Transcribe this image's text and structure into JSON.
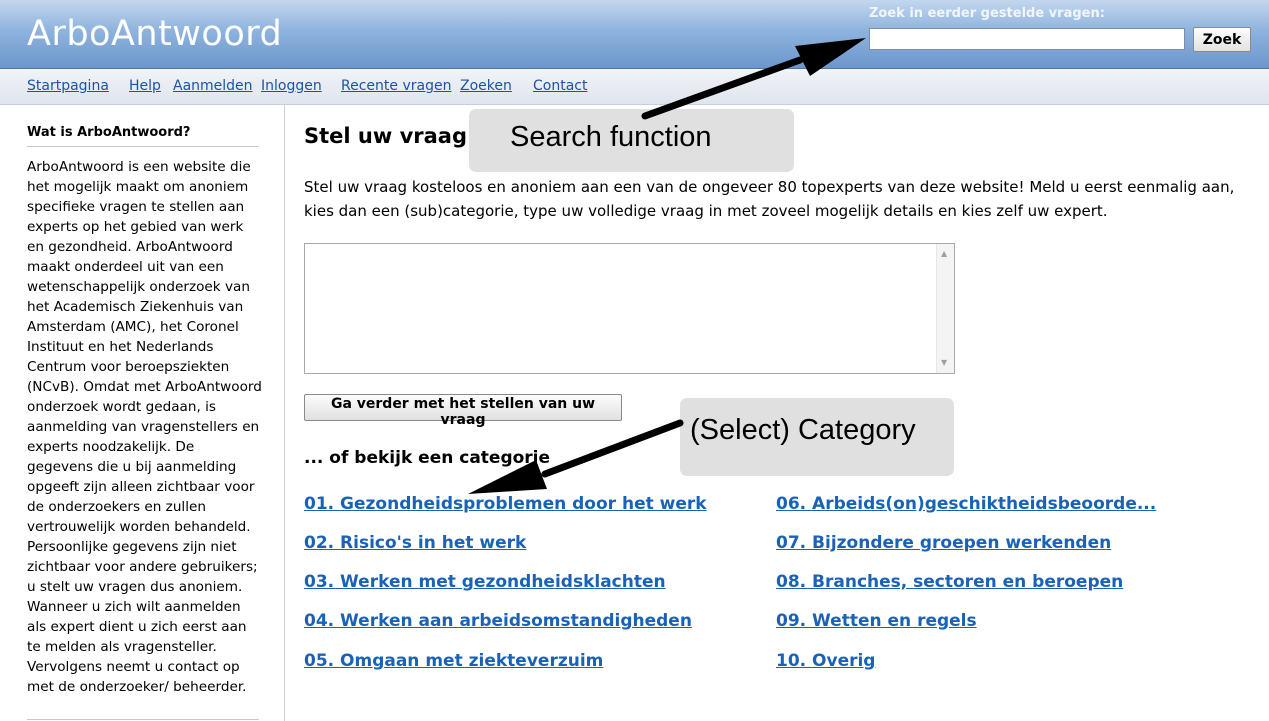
{
  "header": {
    "site_title": "ArboAntwoord",
    "search_label": "Zoek in eerder gestelde vragen:",
    "search_value": "",
    "search_button": "Zoek"
  },
  "nav": {
    "items": [
      "Startpagina",
      "Help",
      "Aanmelden",
      "Inloggen",
      "Recente vragen",
      "Zoeken",
      "Contact"
    ]
  },
  "sidebar": {
    "title": "Wat is ArboAntwoord?",
    "text": "ArboAntwoord is een website die het mogelijk maakt om anoniem specifieke vragen te stellen aan experts op het gebied van werk en gezondheid. ArboAntwoord maakt onderdeel uit van een wetenschappelijk onderzoek van het Academisch Ziekenhuis van Amsterdam (AMC), het Coronel Instituut en het Nederlands Centrum voor beroepsziekten (NCvB). Omdat met ArboAntwoord onderzoek wordt gedaan, is aanmelding van vragenstellers en experts noodzakelijk. De gegevens die u bij aanmelding opgeeft zijn alleen zichtbaar voor de onderzoekers en zullen vertrouwelijk worden behandeld. Persoonlijke gegevens zijn niet zichtbaar voor andere gebruikers; u stelt uw vragen dus anoniem. Wanneer u zich wilt aanmelden als expert dient u zich eerst aan te melden als vragensteller. Vervolgens neemt u contact op met de onderzoeker/ beheerder."
  },
  "main": {
    "heading": "Stel uw vraag",
    "intro": "Stel uw vraag kosteloos en anoniem aan een van de ongeveer 80 topexperts van deze website! Meld u eerst eenmalig aan, kies dan een (sub)categorie, type uw volledige vraag in met zoveel mogelijk details en kies zelf uw expert.",
    "question_value": "",
    "continue_button": "Ga verder met het stellen van uw vraag",
    "categories_heading": "... of bekijk een categorie",
    "categories": [
      "01. Gezondheidsproblemen door het werk",
      "02. Risico's in het werk",
      "03. Werken met gezondheidsklachten",
      "04. Werken aan arbeidsomstandigheden",
      "05. Omgaan met ziekteverzuim",
      "06. Arbeids(on)geschiktheidsbeoorde...",
      "07. Bijzondere groepen werkenden",
      "08. Branches, sectoren en beroepen",
      "09. Wetten en regels",
      "10. Overig"
    ]
  },
  "annotations": {
    "search_callout": "Search function",
    "category_callout": "(Select) Category"
  },
  "colors": {
    "header_blue": "#6b97cc",
    "link_blue": "#1a62b8",
    "callout_gray": "#e0e0e0"
  }
}
